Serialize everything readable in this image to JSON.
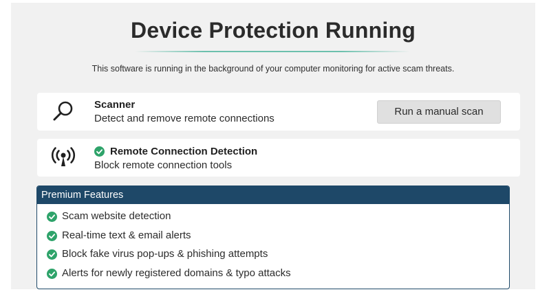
{
  "header": {
    "title": "Device Protection Running",
    "subtitle": "This software is running in the background of your computer monitoring for active scam threats."
  },
  "scanner": {
    "icon": "search-icon",
    "title": "Scanner",
    "description": "Detect and remove remote connections",
    "button_label": "Run a manual scan"
  },
  "remote_detection": {
    "icon": "broadcast-antenna-icon",
    "status_icon": "check-circle-icon",
    "title": "Remote Connection Detection",
    "description": "Block remote connection tools"
  },
  "premium": {
    "header": "Premium Features",
    "features": [
      "Scam website detection",
      "Real-time text & email alerts",
      "Block fake virus pop-ups & phishing attempts",
      "Alerts for newly registered domains & typo attacks"
    ]
  },
  "colors": {
    "accent_green": "#2ea36a",
    "premium_navy": "#1e4868",
    "panel_background": "#f1f1f1",
    "divider": "#6cc0ad"
  }
}
